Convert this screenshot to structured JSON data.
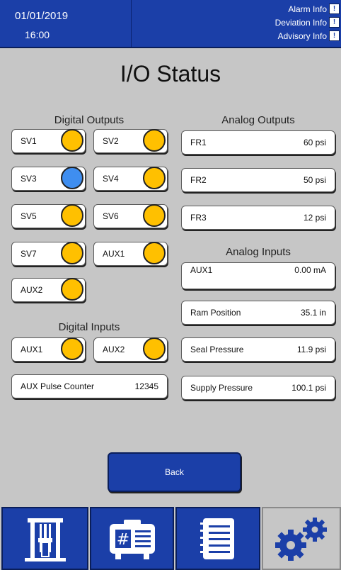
{
  "header": {
    "date": "01/01/2019",
    "time": "16:00",
    "alarm_info": "Alarm Info",
    "deviation_info": "Deviation Info",
    "advisory_info": "Advisory Info"
  },
  "title": "I/O Status",
  "digital_outputs": {
    "title": "Digital Outputs",
    "items": [
      {
        "label": "SV1",
        "color": "#ffc000"
      },
      {
        "label": "SV2",
        "color": "#ffc000"
      },
      {
        "label": "SV3",
        "color": "#3f8ef0"
      },
      {
        "label": "SV4",
        "color": "#ffc000"
      },
      {
        "label": "SV5",
        "color": "#ffc000"
      },
      {
        "label": "SV6",
        "color": "#ffc000"
      },
      {
        "label": "SV7",
        "color": "#ffc000"
      },
      {
        "label": "AUX1",
        "color": "#ffc000"
      },
      {
        "label": "AUX2",
        "color": "#ffc000"
      }
    ]
  },
  "digital_inputs": {
    "title": "Digital Inputs",
    "items": [
      {
        "label": "AUX1",
        "color": "#ffc000"
      },
      {
        "label": "AUX2",
        "color": "#ffc000"
      }
    ],
    "pulse_counter": {
      "label": "AUX Pulse Counter",
      "value": "12345"
    }
  },
  "analog_outputs": {
    "title": "Analog Outputs",
    "items": [
      {
        "label": "FR1",
        "value": "60 psi"
      },
      {
        "label": "FR2",
        "value": "50 psi"
      },
      {
        "label": "FR3",
        "value": "12 psi"
      }
    ]
  },
  "analog_inputs": {
    "title": "Analog Inputs",
    "items": [
      {
        "label": "AUX1",
        "value": "0.00 mA"
      },
      {
        "label": "Ram Position",
        "value": "35.1 in"
      },
      {
        "label": "Seal Pressure",
        "value": "11.9 psi"
      },
      {
        "label": "Supply Pressure",
        "value": "100.1 psi"
      }
    ]
  },
  "back_label": "Back",
  "nav": {
    "tabs": [
      "pump-icon",
      "controller-icon",
      "log-icon",
      "settings-gears-icon"
    ],
    "active_tab": 3
  },
  "colors": {
    "accent": "#1b3fa8",
    "led_on": "#ffc000",
    "led_blue": "#3f8ef0"
  }
}
